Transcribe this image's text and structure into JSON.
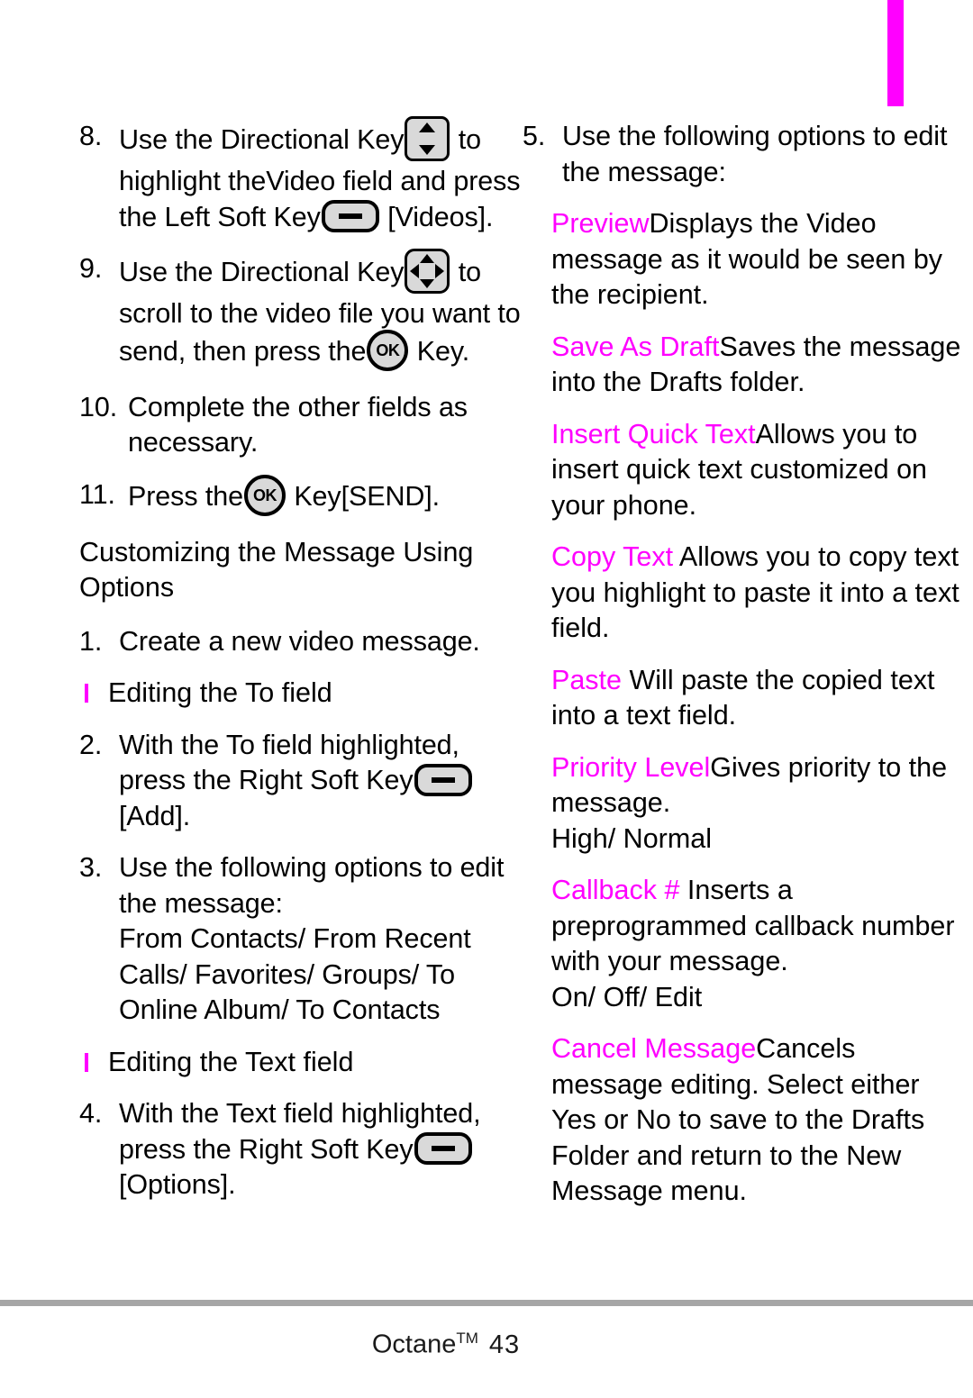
{
  "page": {
    "footer_brand": "Octane",
    "footer_trademark": "TM",
    "page_number": "43",
    "accent_color": "#ff00ff",
    "rule_color": "#a6a6a6"
  },
  "icons": {
    "updown_key": "directional-key-updown-icon",
    "fourway_key": "directional-key-4way-icon",
    "soft_key": "soft-key-icon",
    "ok_key": "ok-key-icon",
    "ok_label": "OK"
  },
  "left_column": {
    "step8": {
      "number": "8.",
      "text_a": "Use the Directional Key",
      "text_b": "to highlight the",
      "emphasis": "Video",
      "text_c": "field and press the Left Soft Key",
      "text_d": "[Videos]."
    },
    "step9": {
      "number": "9.",
      "text_a": "Use the Directional Key",
      "text_b": "to",
      "text_c": "scroll to the video file you want to send, then press the",
      "text_d": "Key."
    },
    "step10": {
      "number": "10.",
      "text": "Complete the other fields as necessary."
    },
    "step11": {
      "number": "11.",
      "text_a": "Press the",
      "text_b": "Key",
      "text_c": "[SEND]."
    },
    "heading": "Customizing the Message Using Options",
    "step1": {
      "number": "1.",
      "text": "Create a new video message."
    },
    "subhead_to": "Editing the To field",
    "step2": {
      "number": "2.",
      "text_a": "With the To field highlighted, press the Right Soft Key",
      "text_b": "[Add]."
    },
    "step3": {
      "number": "3.",
      "text": "Use the following options to edit the message:",
      "options": "From Contacts/ From Recent Calls/ Favorites/ Groups/ To Online Album/ To Contacts"
    },
    "subhead_text": "Editing the Text field",
    "step4": {
      "number": "4.",
      "text_a": "With the Text field highlighted, press the Right Soft Key",
      "text_b": "[Options]."
    }
  },
  "right_column": {
    "step5": {
      "number": "5.",
      "text": "Use the following options to edit the message:"
    },
    "options": [
      {
        "term": "Preview",
        "description": "Displays the Video message as it would be seen by the recipient.",
        "values": ""
      },
      {
        "term": "Save As Draft",
        "description": "Saves the message into the Drafts folder.",
        "values": ""
      },
      {
        "term": "Insert Quick Text",
        "description": "Allows you to insert quick text customized on your phone.",
        "values": ""
      },
      {
        "term": "Copy Text",
        "description": " Allows you to copy text you highlight to paste it into a text field.",
        "values": ""
      },
      {
        "term": "Paste",
        "description": " Will paste the copied text into a text field.",
        "values": ""
      },
      {
        "term": "Priority Level",
        "description": "Gives priority to the message.",
        "values": "High/ Normal"
      },
      {
        "term": "Callback #",
        "description": " Inserts a preprogrammed callback number with your message.",
        "values": "On/ Off/ Edit"
      },
      {
        "term": "Cancel Message",
        "description": "Cancels message editing. Select either Yes or No to save to the Drafts Folder and return to the New Message menu.",
        "values": ""
      }
    ]
  }
}
